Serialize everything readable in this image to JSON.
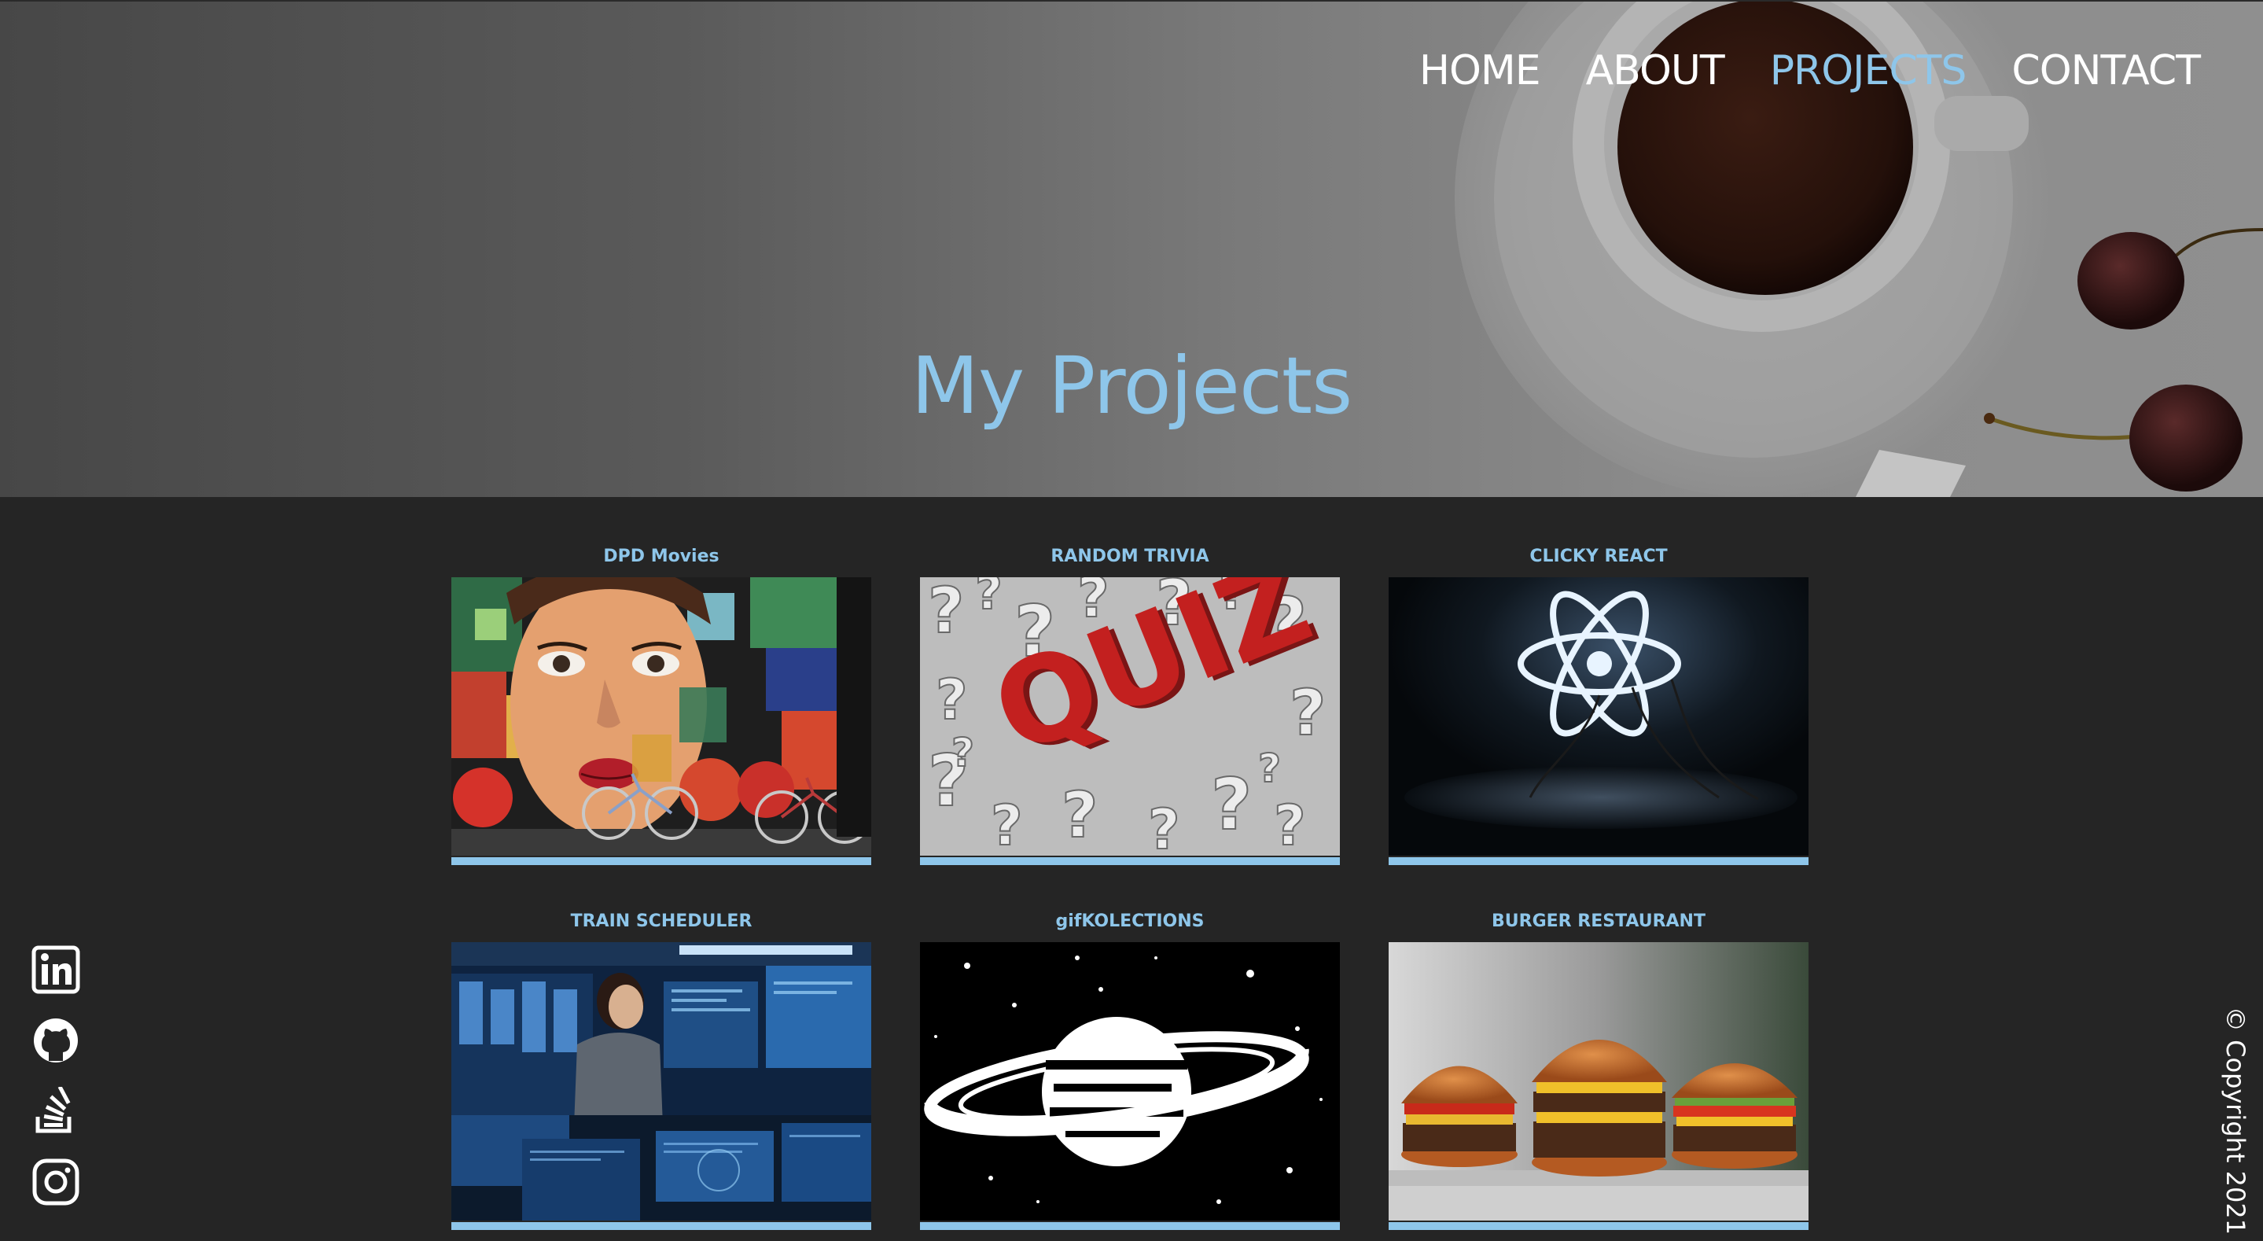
{
  "nav": {
    "items": [
      {
        "label": "HOME",
        "active": false
      },
      {
        "label": "ABOUT",
        "active": false
      },
      {
        "label": "PROJECTS",
        "active": true
      },
      {
        "label": "CONTACT",
        "active": false
      }
    ]
  },
  "hero": {
    "title": "My Projects"
  },
  "projects": [
    {
      "title": "DPD Movies",
      "image": "graffiti-mural-woman-face"
    },
    {
      "title": "RANDOM TRIVIA",
      "image": "quiz-question-marks"
    },
    {
      "title": "CLICKY REACT",
      "image": "neon-react-logo"
    },
    {
      "title": "TRAIN SCHEDULER",
      "image": "control-room-monitors"
    },
    {
      "title": "gifKOLECTIONS",
      "image": "ringed-planet-space"
    },
    {
      "title": "BURGER RESTAURANT",
      "image": "cheeseburgers-tray"
    }
  ],
  "social": [
    "linkedin-icon",
    "github-icon",
    "stackoverflow-icon",
    "instagram-icon"
  ],
  "footer": {
    "copyright": "© Copyright 2021"
  },
  "colors": {
    "accent": "#8ec6ea",
    "background": "#252525",
    "nav_text": "#ffffff"
  }
}
